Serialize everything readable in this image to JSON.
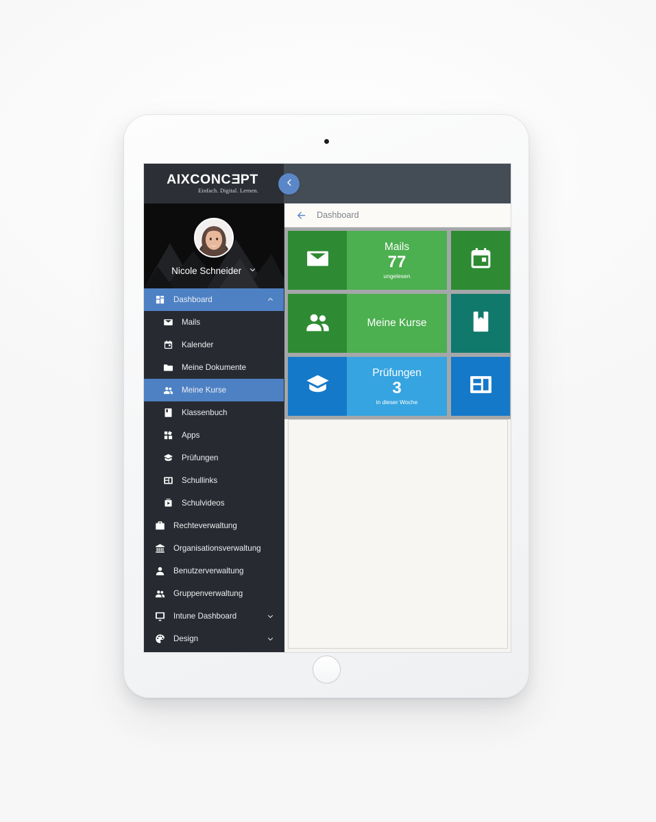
{
  "brand": {
    "name_before": "AIXCONC",
    "name_rev": "E",
    "name_after": "PT",
    "tagline": "Einfach. Digital. Lernen."
  },
  "topbar": {
    "back_label": "back",
    "left_bg": "#2c3036",
    "right_bg": "#444c55",
    "back_bg": "#5b87c8"
  },
  "profile": {
    "name": "Nicole Schneider",
    "chevron": "chevron-down-icon",
    "avatar_alt": "avatar"
  },
  "sidebar": {
    "bg": "#272b31",
    "active_bg": "#4e81c4",
    "items": [
      {
        "label": "Dashboard",
        "icon": "dashboard-grid-icon",
        "active": true,
        "indent": false,
        "chevron": "up"
      },
      {
        "label": "Mails",
        "icon": "envelope-icon",
        "active": false,
        "indent": true,
        "chevron": ""
      },
      {
        "label": "Kalender",
        "icon": "calendar-icon",
        "active": false,
        "indent": true,
        "chevron": ""
      },
      {
        "label": "Meine Dokumente",
        "icon": "folder-icon",
        "active": false,
        "indent": true,
        "chevron": ""
      },
      {
        "label": "Meine Kurse",
        "icon": "people-icon",
        "active": true,
        "indent": true,
        "chevron": ""
      },
      {
        "label": "Klassenbuch",
        "icon": "book-icon",
        "active": false,
        "indent": true,
        "chevron": ""
      },
      {
        "label": "Apps",
        "icon": "apps-grid-icon",
        "active": false,
        "indent": true,
        "chevron": ""
      },
      {
        "label": "Prüfungen",
        "icon": "graduation-cap-icon",
        "active": false,
        "indent": true,
        "chevron": ""
      },
      {
        "label": "Schullinks",
        "icon": "web-layout-icon",
        "active": false,
        "indent": true,
        "chevron": ""
      },
      {
        "label": "Schulvideos",
        "icon": "video-icon",
        "active": false,
        "indent": true,
        "chevron": ""
      },
      {
        "label": "Rechteverwaltung",
        "icon": "briefcase-icon",
        "active": false,
        "indent": false,
        "chevron": ""
      },
      {
        "label": "Organisationsverwaltung",
        "icon": "bank-icon",
        "active": false,
        "indent": false,
        "chevron": ""
      },
      {
        "label": "Benutzerverwaltung",
        "icon": "person-icon",
        "active": false,
        "indent": false,
        "chevron": ""
      },
      {
        "label": "Gruppenverwaltung",
        "icon": "people-icon",
        "active": false,
        "indent": false,
        "chevron": ""
      },
      {
        "label": "Intune Dashboard",
        "icon": "presentation-icon",
        "active": false,
        "indent": false,
        "chevron": "down"
      },
      {
        "label": "Design",
        "icon": "palette-icon",
        "active": false,
        "indent": false,
        "chevron": "down"
      }
    ]
  },
  "breadcrumb": {
    "arrow": "arrow-left-icon",
    "title": "Dashboard"
  },
  "tiles": {
    "background": "#a4a7a9",
    "rows": [
      {
        "wide": {
          "name": "mails",
          "icon": "envelope-icon",
          "title": "Mails",
          "value": "77",
          "sub": "ungelesen",
          "icon_bg": "#2e8b33",
          "body_bg": "#4caf50"
        },
        "square": {
          "name": "kalender",
          "icon": "calendar-icon",
          "bg": "#2e8b33"
        }
      },
      {
        "wide": {
          "name": "meine-kurse",
          "icon": "people-icon",
          "title": "Meine Kurse",
          "value": "",
          "sub": "",
          "icon_bg": "#2e8b33",
          "body_bg": "#4caf50"
        },
        "square": {
          "name": "klassenbuch",
          "icon": "bookmark-book-icon",
          "bg": "#10796c"
        }
      },
      {
        "wide": {
          "name": "pruefungen",
          "icon": "graduation-cap-icon",
          "title": "Prüfungen",
          "value": "3",
          "sub": "in dieser Woche",
          "icon_bg": "#1479c9",
          "body_bg": "#36a4e0"
        },
        "square": {
          "name": "schullinks",
          "icon": "web-layout-icon",
          "bg": "#1479c9"
        }
      }
    ]
  },
  "content": {
    "empty": ""
  },
  "device": {
    "camera": "camera-dot",
    "home_button": "home-button"
  }
}
